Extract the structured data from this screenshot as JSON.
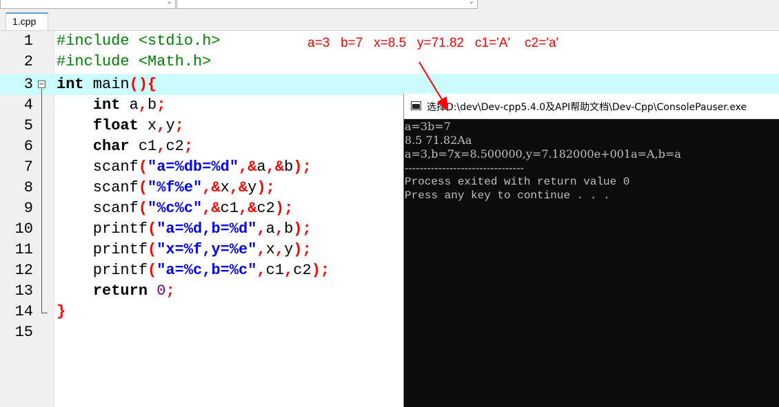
{
  "tabs": [
    {
      "label": "1.cpp"
    }
  ],
  "editor": {
    "line_numbers": [
      "1",
      "2",
      "3",
      "4",
      "5",
      "6",
      "7",
      "8",
      "9",
      "10",
      "11",
      "12",
      "13",
      "14",
      "15"
    ],
    "current_line": 3,
    "fold_marker": "−"
  },
  "annotation": {
    "text": "a=3   b=7   x=8.5   y=71.82   c1='A'    c2='a'",
    "color": "#ff0000"
  },
  "console": {
    "title": "选择D:\\dev\\Dev-cpp5.4.0及API帮助文档\\Dev-Cpp\\ConsolePauser.exe",
    "lines": [
      "a=3b=7",
      "8.5 71.82Aa",
      "a=3,b=7x=8.500000,y=7.182000e+001a=A,b=a",
      "--------------------------------",
      "Process exited with return value 0",
      "Press any key to continue . . ."
    ]
  },
  "code": {
    "l1": {
      "a": "#include <stdio.h>"
    },
    "l2": {
      "a": "#include <Math.h>"
    },
    "l3": {
      "a": "int",
      "b": " main",
      "c": "(){"
    },
    "l4": {
      "a": "    ",
      "b": "int",
      "c": " a",
      "d": ",",
      "e": "b",
      "f": ";"
    },
    "l5": {
      "a": "    ",
      "b": "float",
      "c": " x",
      "d": ",",
      "e": "y",
      "f": ";"
    },
    "l6": {
      "a": "    ",
      "b": "char",
      "c": " c1",
      "d": ",",
      "e": "c2",
      "f": ";"
    },
    "l7": {
      "a": "    scanf",
      "b": "(",
      "c": "\"a=%db=%d\"",
      "d": ",&",
      "e": "a",
      "f": ",&",
      "g": "b",
      "h": ");"
    },
    "l8": {
      "a": "    scanf",
      "b": "(",
      "c": "\"%f%e\"",
      "d": ",&",
      "e": "x",
      "f": ",&",
      "g": "y",
      "h": ");"
    },
    "l9": {
      "a": "    scanf",
      "b": "(",
      "c": "\"%c%c\"",
      "d": ",&",
      "e": "c1",
      "f": ",&",
      "g": "c2",
      "h": ");"
    },
    "l10": {
      "a": "    printf",
      "b": "(",
      "c": "\"a=%d,b=%d\"",
      "d": ",",
      "e": "a",
      "f": ",",
      "g": "b",
      "h": ");"
    },
    "l11": {
      "a": "    printf",
      "b": "(",
      "c": "\"x=%f,y=%e\"",
      "d": ",",
      "e": "x",
      "f": ",",
      "g": "y",
      "h": ");"
    },
    "l12": {
      "a": "    printf",
      "b": "(",
      "c": "\"a=%c,b=%c\"",
      "d": ",",
      "e": "c1",
      "f": ",",
      "g": "c2",
      "h": ");"
    },
    "l13": {
      "a": "    ",
      "b": "return",
      "c": " ",
      "d": "0",
      "e": ";"
    },
    "l14": {
      "a": "}"
    }
  }
}
